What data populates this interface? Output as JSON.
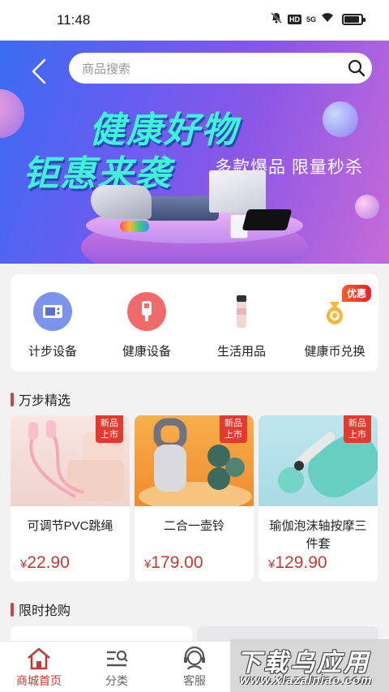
{
  "status_bar": {
    "time": "11:48",
    "network": "5G",
    "hd": "HD"
  },
  "search": {
    "placeholder": "商品搜索"
  },
  "banner": {
    "title_line1": "健康好物",
    "title_line2": "钜惠来袭",
    "subtitle": "多款爆品 限量秒杀"
  },
  "categories": [
    {
      "label": "计步设备",
      "icon": "pedometer-icon",
      "color": "#6f8ae8"
    },
    {
      "label": "健康设备",
      "icon": "glucose-meter-icon",
      "color": "#f06a6a"
    },
    {
      "label": "生活用品",
      "icon": "tumbler-icon",
      "color": "#f3c2c2"
    },
    {
      "label": "健康币兑换",
      "icon": "money-bag-icon",
      "color": "#f5b63a"
    }
  ],
  "promo_tag": "优惠",
  "section_steps": "万步精选",
  "products": [
    {
      "name": "可调节PVC跳绳",
      "currency": "¥",
      "price": "22.90",
      "badge_line1": "新品",
      "badge_line2": "上市"
    },
    {
      "name": "二合一壶铃",
      "currency": "¥",
      "price": "179.00",
      "badge_line1": "新品",
      "badge_line2": "上市"
    },
    {
      "name": "瑜伽泡沫轴按摩三件套",
      "currency": "¥",
      "price": "129.90",
      "badge_line1": "新品",
      "badge_line2": "上市"
    }
  ],
  "section_flash": "限时抢购",
  "nav": [
    {
      "label": "商城首页",
      "icon": "home-icon",
      "active": true
    },
    {
      "label": "分类",
      "icon": "category-icon",
      "active": false
    },
    {
      "label": "客服",
      "icon": "customer-service-icon",
      "active": false
    }
  ],
  "watermark": {
    "big": "下载乌应用",
    "small": "www.xlazalniao.com"
  },
  "colors": {
    "accent": "#c43a32",
    "banner_start": "#3a6cf2",
    "banner_end": "#c66bd8"
  }
}
